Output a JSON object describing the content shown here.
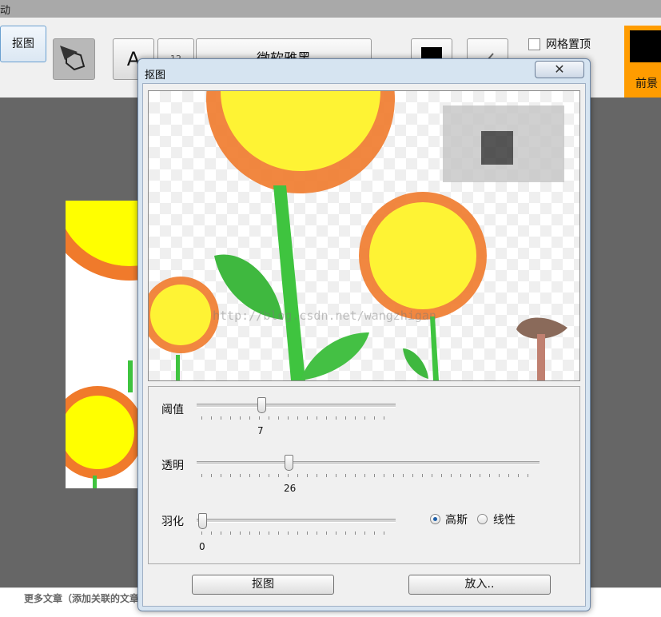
{
  "app": {
    "title_fragment": "动",
    "toolbar": {
      "matting_button": "抠图",
      "font_button": "A",
      "font_size_button": "12",
      "font_name": "微软雅黑",
      "grid_top_checkbox": "网格置顶",
      "foreground_button": "前景"
    },
    "footer_text": "更多文章（添加关联的文章"
  },
  "dialog": {
    "title": "抠图",
    "close_glyph": "✕",
    "preview": {
      "watermark": "http://blog.csdn.net/wangzhigan"
    },
    "sliders": [
      {
        "label": "阈值",
        "value": "7",
        "fraction": 0.33
      },
      {
        "label": "透明",
        "value": "26",
        "fraction": 0.26
      },
      {
        "label": "羽化",
        "value": "0",
        "fraction": 0.0
      }
    ],
    "feather_mode": {
      "options": [
        "高斯",
        "线性"
      ],
      "selected": "高斯"
    },
    "buttons": {
      "matting": "抠图",
      "place_in": "放入.."
    }
  },
  "colors": {
    "petal_orange": "#f07a2b",
    "flower_yellow": "#ffff33",
    "stem_green": "#3fc43f",
    "workspace_gray": "#666666",
    "foreground_accent": "#ff9c00"
  }
}
